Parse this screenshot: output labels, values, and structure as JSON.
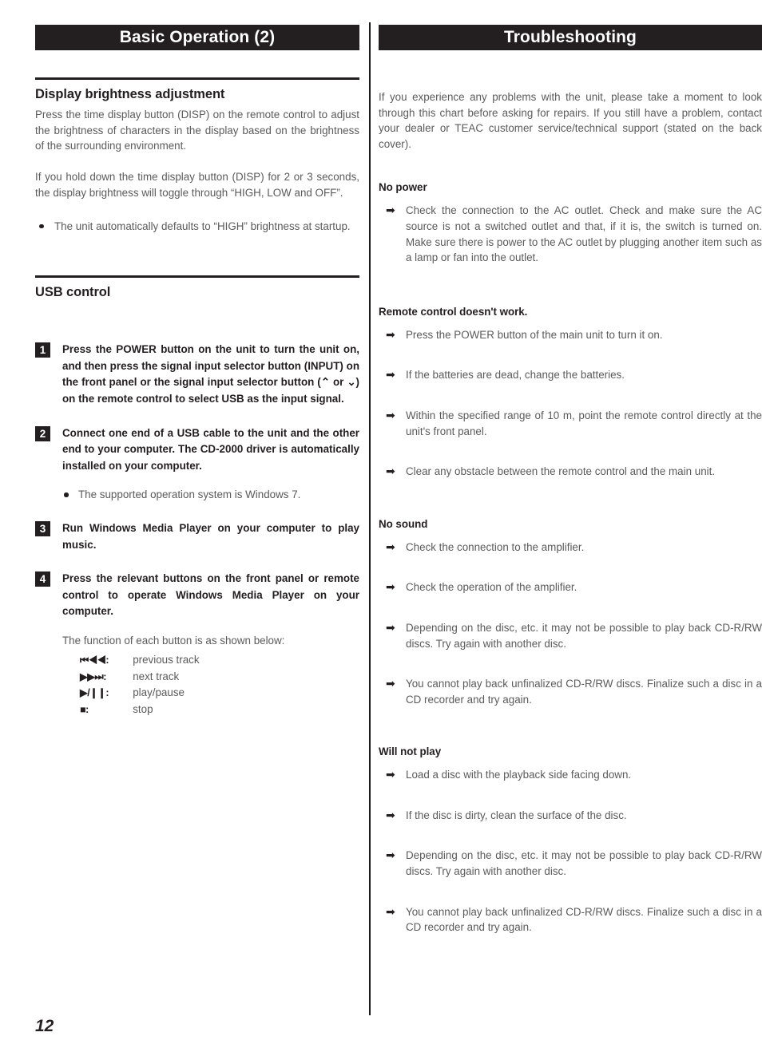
{
  "page": {
    "number": "12"
  },
  "left_column": {
    "header": "Basic Operation (2)",
    "section_brightness": {
      "heading": "Display brightness adjustment",
      "paragraph_1": "Press the time display button (DISP) on the remote control to adjust the brightness of characters in the display based on the brightness of the surrounding environment.",
      "paragraph_2": "If you hold down the time display button (DISP) for 2 or 3 seconds, the display brightness will toggle through “HIGH, LOW and OFF”.",
      "bullet_1": "The unit automatically defaults to “HIGH” brightness at startup."
    },
    "section_usb": {
      "heading": "USB control",
      "steps": [
        {
          "number": "1",
          "text": "Press the POWER button on the unit to turn the unit on, and then press the signal input selector button (INPUT) on the front panel or the signal input selector button (⌃ or ⌄) on the remote control to select USB as the input signal."
        },
        {
          "number": "2",
          "text": "Connect one end of a USB cable to the unit and the other end to your computer. The CD-2000 driver is automatically installed on your computer.",
          "bullet": "The supported operation system is Windows 7."
        },
        {
          "number": "3",
          "text": "Run Windows Media Player on your computer to play music."
        },
        {
          "number": "4",
          "text": "Press the relevant buttons on the front panel or remote control to operate Windows Media Player on your computer.",
          "note": "The function of each button is as shown below:",
          "legend": [
            {
              "symbol": "⏮◀◀:",
              "description": "previous track"
            },
            {
              "symbol": "▶▶⏭:",
              "description": "next track"
            },
            {
              "symbol": "▶/❙❙:",
              "description": "play/pause"
            },
            {
              "symbol": "■:",
              "description": "stop"
            }
          ]
        }
      ]
    }
  },
  "right_column": {
    "header": "Troubleshooting",
    "intro": "If you experience any problems with the unit, please take a moment to look through this chart before asking for repairs. If you still have a problem, contact your dealer or TEAC customer service/technical support (stated on the back cover).",
    "sections": [
      {
        "heading": "No power",
        "items": [
          "Check the connection to the AC outlet. Check and make sure the AC source is not a switched outlet and that, if it is, the switch is turned on. Make sure there is power to the AC outlet by plugging another item such as a lamp or fan into the outlet."
        ]
      },
      {
        "heading": "Remote control doesn't work.",
        "items": [
          "Press the POWER button of the main unit to turn it on.",
          "If the batteries are dead, change the batteries.",
          "Within the specified range of 10 m, point the remote control directly at the unit's front panel.",
          "Clear any obstacle between the remote control and the main unit."
        ]
      },
      {
        "heading": "No sound",
        "items": [
          "Check the connection to the amplifier.",
          "Check the operation of the amplifier.",
          "Depending on the disc, etc. it may not be possible to play back CD-R/RW discs. Try again with another disc.",
          "You cannot play back unfinalized CD-R/RW discs. Finalize such a disc in a CD recorder and try again."
        ]
      },
      {
        "heading": "Will not play",
        "items": [
          "Load a disc with the playback side facing down.",
          "If the disc is dirty, clean the surface of the disc.",
          "Depending on the disc, etc. it may not be possible to play back CD-R/RW discs. Try again with another disc.",
          "You cannot play back unfinalized CD-R/RW discs. Finalize such a disc in a CD recorder and try again."
        ]
      }
    ],
    "arrow_glyph": "➡"
  },
  "colors": {
    "ink": "#231f20",
    "body_text": "#5b5b5b",
    "bar_background": "#231f20",
    "bar_text": "#ffffff"
  }
}
